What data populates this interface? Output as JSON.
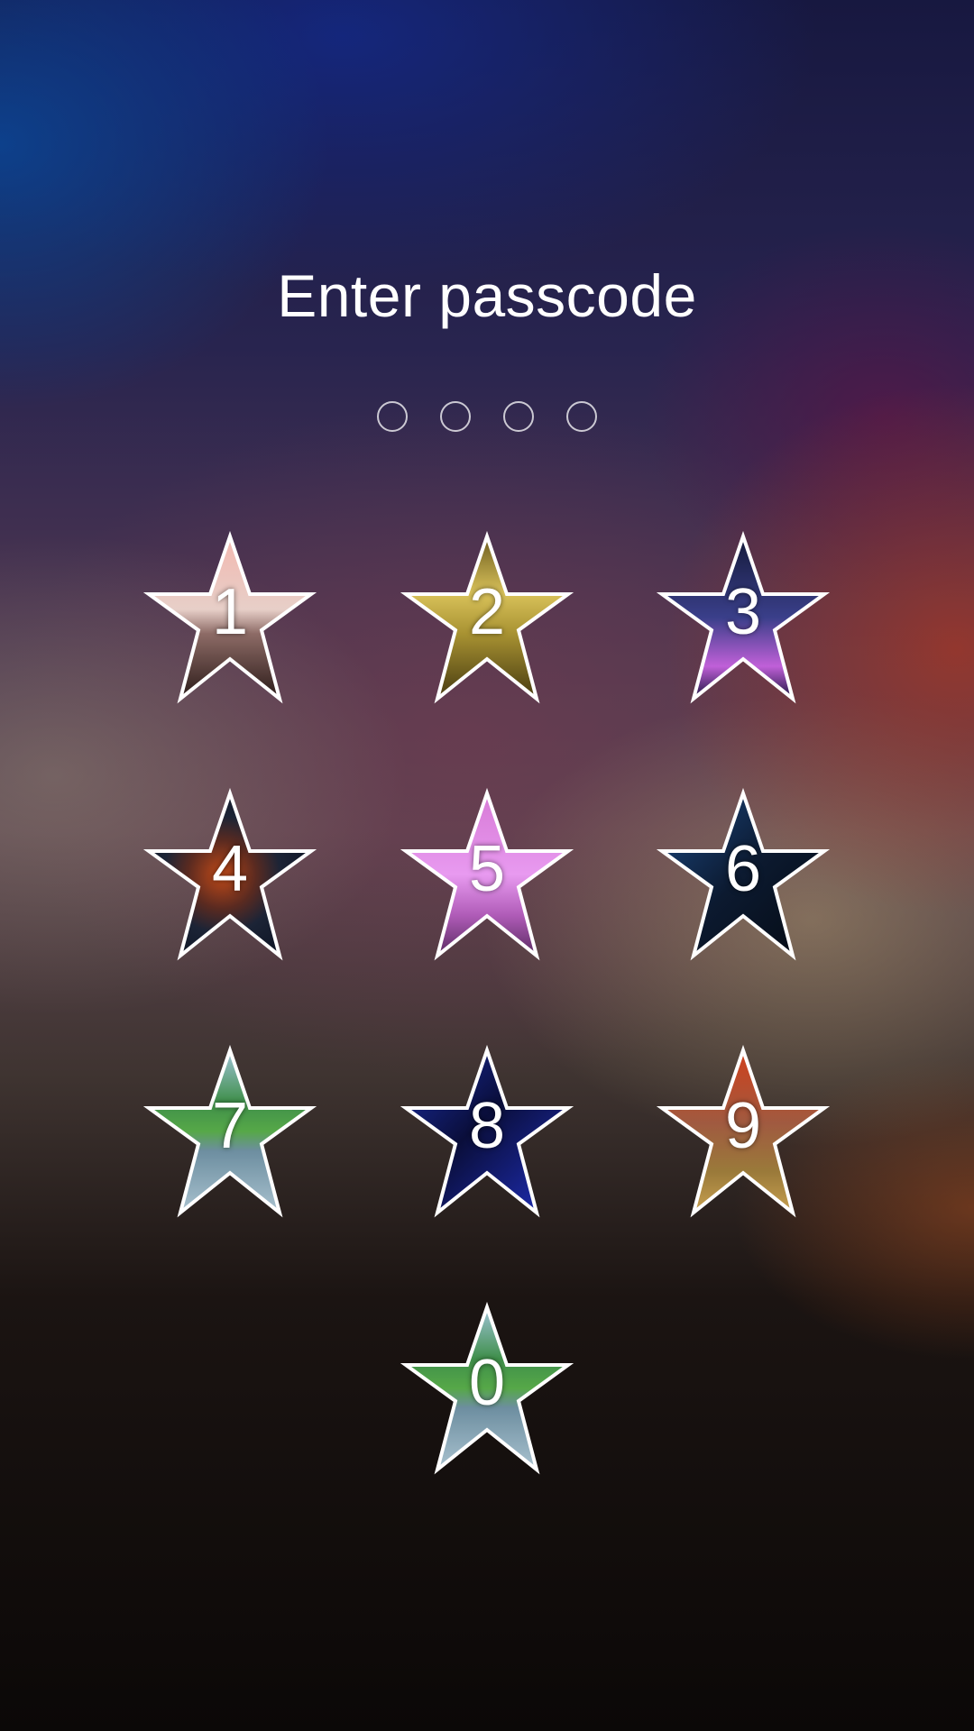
{
  "lockscreen": {
    "title": "Enter passcode",
    "passcode_length": 4,
    "entered_count": 0
  },
  "keypad": {
    "keys": [
      {
        "digit": "1",
        "theme": "sunset-car"
      },
      {
        "digit": "2",
        "theme": "desert-camels"
      },
      {
        "digit": "3",
        "theme": "city-night"
      },
      {
        "digit": "4",
        "theme": "planet-space"
      },
      {
        "digit": "5",
        "theme": "savanna-tree"
      },
      {
        "digit": "6",
        "theme": "blue-light-rays"
      },
      {
        "digit": "7",
        "theme": "green-lake"
      },
      {
        "digit": "8",
        "theme": "blue-light-streaks"
      },
      {
        "digit": "9",
        "theme": "red-sky-field"
      },
      {
        "digit": "0",
        "theme": "green-lake"
      }
    ]
  },
  "colors": {
    "text": "#ffffff",
    "star_outline": "#ffffff"
  }
}
